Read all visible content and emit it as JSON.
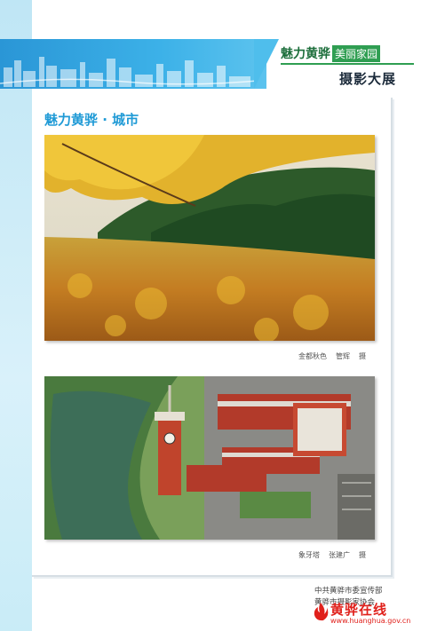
{
  "header": {
    "brand_main": "魅力黄骅",
    "brand_tag": "美丽家园",
    "section": "摄影大展",
    "skyline_icon": "city-skyline-illustration"
  },
  "page": {
    "title": "魅力黄骅 · 城市"
  },
  "photos": [
    {
      "caption_title": "金都秋色",
      "caption_author": "管辉",
      "caption_suffix": "摄"
    },
    {
      "caption_title": "象牙塔",
      "caption_author": "张建广",
      "caption_suffix": "摄"
    }
  ],
  "footer": {
    "line1": "中共黄骅市委宣传部",
    "line2": "黄骅市摄影家协会"
  },
  "watermark": {
    "title": "黄骅在线",
    "url": "www.huanghua.gov.cn"
  },
  "colors": {
    "accent": "#1f9ad6",
    "header_blue": "#2a96d6",
    "brand_green": "#2f9e52",
    "watermark_red": "#e0201b"
  }
}
